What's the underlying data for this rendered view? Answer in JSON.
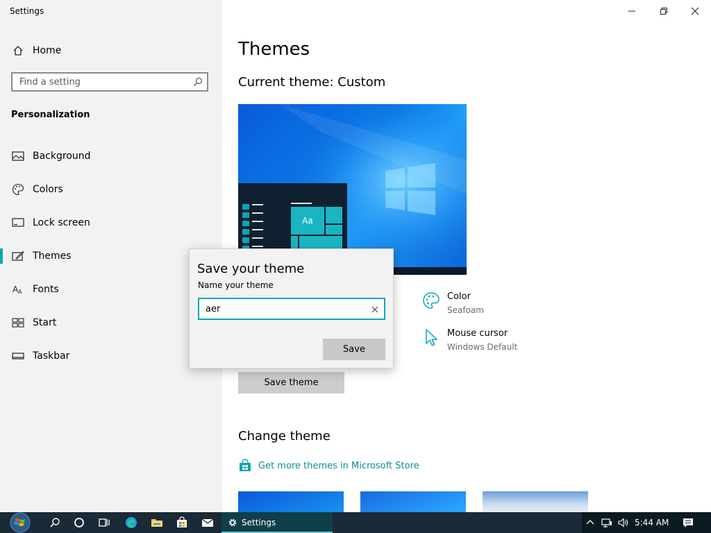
{
  "app": {
    "title": "Settings"
  },
  "sidebar": {
    "home_label": "Home",
    "search_placeholder": "Find a setting",
    "section_title": "Personalization",
    "items": [
      {
        "label": "Background",
        "icon": "picture-icon"
      },
      {
        "label": "Colors",
        "icon": "palette-icon"
      },
      {
        "label": "Lock screen",
        "icon": "lock-screen-icon"
      },
      {
        "label": "Themes",
        "icon": "brush-icon",
        "active": true
      },
      {
        "label": "Fonts",
        "icon": "font-icon"
      },
      {
        "label": "Start",
        "icon": "start-tiles-icon"
      },
      {
        "label": "Taskbar",
        "icon": "taskbar-icon"
      }
    ]
  },
  "main": {
    "page_title": "Themes",
    "current_theme_label": "Current theme:",
    "current_theme_value": "Custom",
    "preview_tile_text": "Aa",
    "props": [
      {
        "title": "Color",
        "value": "Seafoam",
        "icon": "palette-icon"
      },
      {
        "title": "Mouse cursor",
        "value": "Windows Default",
        "icon": "cursor-icon"
      }
    ],
    "save_theme_button": "Save theme",
    "change_theme_heading": "Change theme",
    "store_link": "Get more themes in Microsoft Store"
  },
  "dialog": {
    "title": "Save your theme",
    "label": "Name your theme",
    "input_value": "aer",
    "save_button": "Save"
  },
  "taskbar": {
    "active_app": "Settings",
    "clock": "5:44 AM"
  },
  "colors": {
    "accent": "#0ba5b5",
    "link": "#0b8a96",
    "sidebar_bg": "#f2f2f2",
    "taskbar_bg": "#1a2a36"
  }
}
